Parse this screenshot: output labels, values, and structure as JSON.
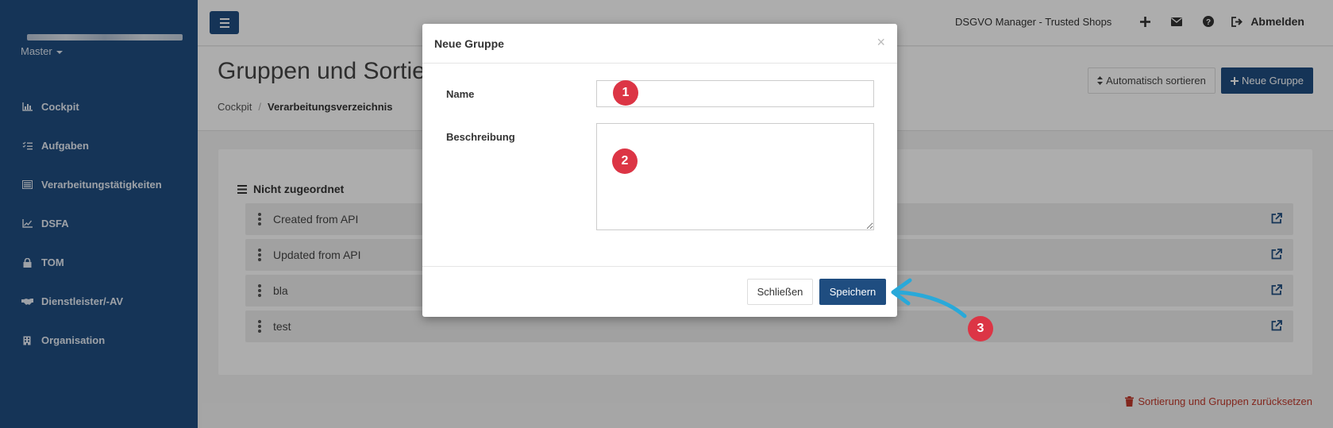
{
  "sidebar": {
    "master_label": "Master",
    "items": [
      {
        "label": "Cockpit",
        "icon": "chart-icon"
      },
      {
        "label": "Aufgaben",
        "icon": "tasks-icon"
      },
      {
        "label": "Verarbeitungstätigkeiten",
        "icon": "list-icon"
      },
      {
        "label": "DSFA",
        "icon": "line-chart-icon"
      },
      {
        "label": "TOM",
        "icon": "lock-icon"
      },
      {
        "label": "Dienstleister/-AV",
        "icon": "handshake-icon"
      },
      {
        "label": "Organisation",
        "icon": "building-icon"
      }
    ]
  },
  "topbar": {
    "app_name": "DSGVO Manager - Trusted Shops",
    "logout_label": "Abmelden"
  },
  "header": {
    "title": "Gruppen und Sortierung",
    "breadcrumb": [
      "Cockpit",
      "Verarbeitungsverzeichnis"
    ],
    "auto_sort_label": "Automatisch sortieren",
    "new_group_label": "Neue Gruppe"
  },
  "content": {
    "group_title": "Nicht zugeordnet",
    "rows": [
      "Created from API",
      "Updated from API",
      "bla",
      "test"
    ],
    "reset_label": "Sortierung und Gruppen zurücksetzen"
  },
  "modal": {
    "title": "Neue Gruppe",
    "close_symbol": "×",
    "name_label": "Name",
    "name_value": "",
    "description_label": "Beschreibung",
    "description_value": "",
    "close_button": "Schließen",
    "save_button": "Speichern"
  },
  "annotations": {
    "marker_1": "1",
    "marker_2": "2",
    "marker_3": "3"
  },
  "colors": {
    "sidebar": "#1f4d80",
    "primary": "#1f4d80",
    "marker": "#dc3545",
    "arrow": "#29a9d9",
    "reset": "#c0392b"
  }
}
